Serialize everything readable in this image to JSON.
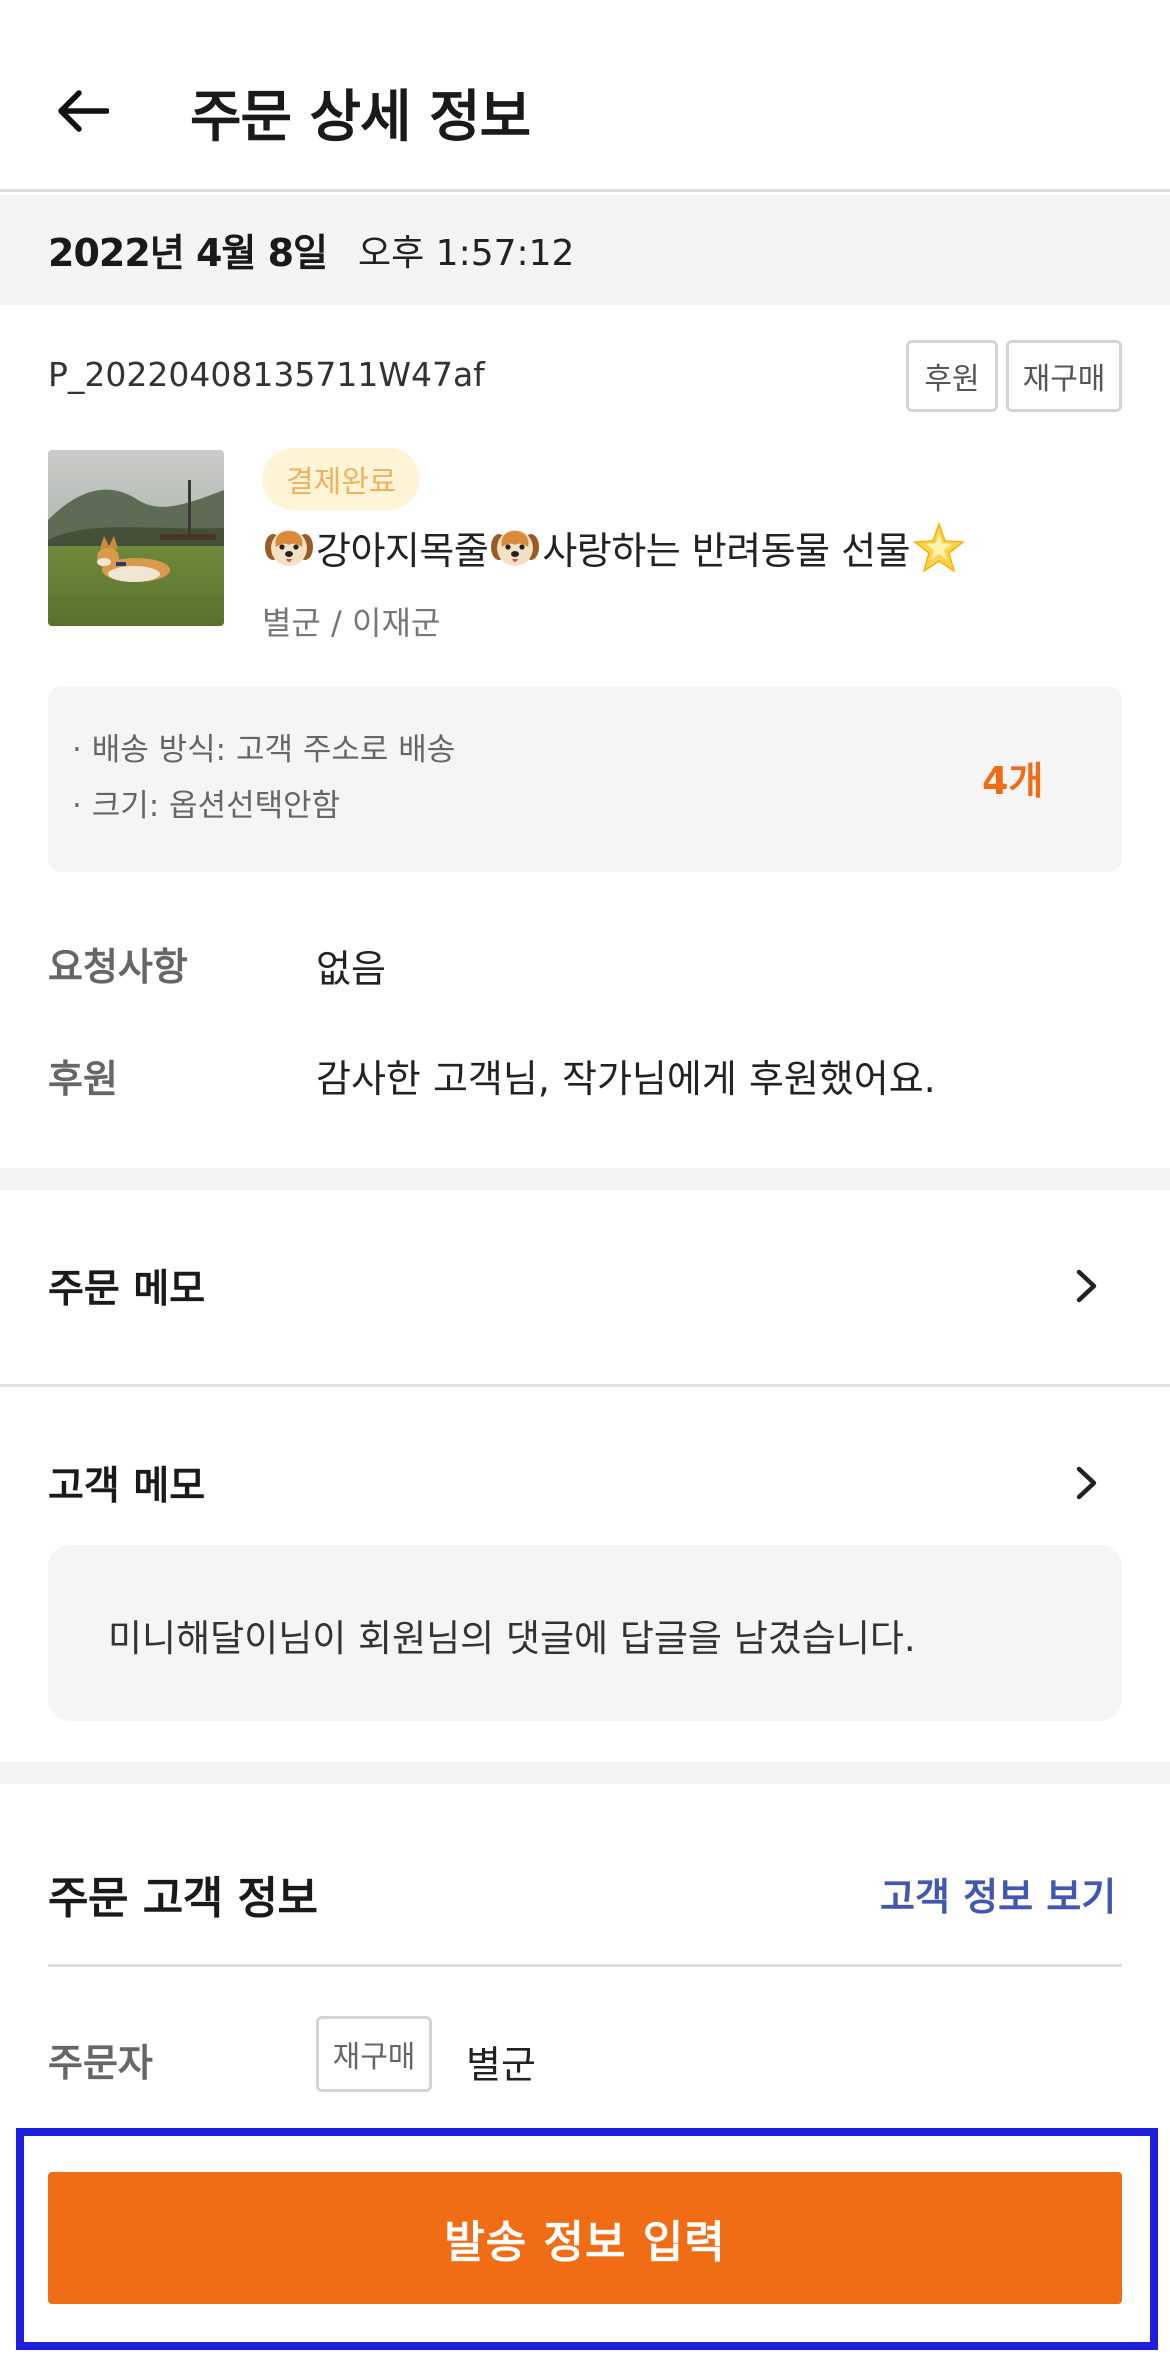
{
  "header": {
    "title": "주문 상세 정보",
    "back_icon": "arrow-left-icon"
  },
  "order": {
    "date": "2022년 4월 8일",
    "time": "오후 1:57:12",
    "id": "P_20220408135711W47af",
    "tags": [
      "후원",
      "재구매"
    ]
  },
  "product": {
    "status": "결제완료",
    "title_parts": [
      "강아지목줄",
      "사랑하는 반려동물 선물"
    ],
    "title_icons": [
      "dog-face-icon",
      "dog-face-icon",
      "star-icon"
    ],
    "subtitle": "별군 / 이재군",
    "options": [
      "· 배송 방식: 고객 주소로 배송",
      "· 크기: 옵션선택안함"
    ],
    "quantity": "4개"
  },
  "details": {
    "request_label": "요청사항",
    "request_value": "없음",
    "sponsor_label": "후원",
    "sponsor_value": "감사한 고객님, 작가님에게 후원했어요."
  },
  "memos": {
    "order_memo_title": "주문 메모",
    "customer_memo_title": "고객 메모",
    "customer_memo_text": "미니해달이님이 회원님의 댓글에 답글을 남겼습니다."
  },
  "customer": {
    "title": "주문 고객 정보",
    "link": "고객 정보 보기",
    "buyer_label": "주문자",
    "buyer_tag": "재구매",
    "buyer_name": "별군"
  },
  "cta": {
    "label": "발송 정보 입력"
  },
  "colors": {
    "accent": "#f06d15",
    "link": "#4257b2",
    "highlight_border": "#1f1fe0",
    "status_bg": "#fff4d6",
    "status_text": "#f0b25c"
  }
}
